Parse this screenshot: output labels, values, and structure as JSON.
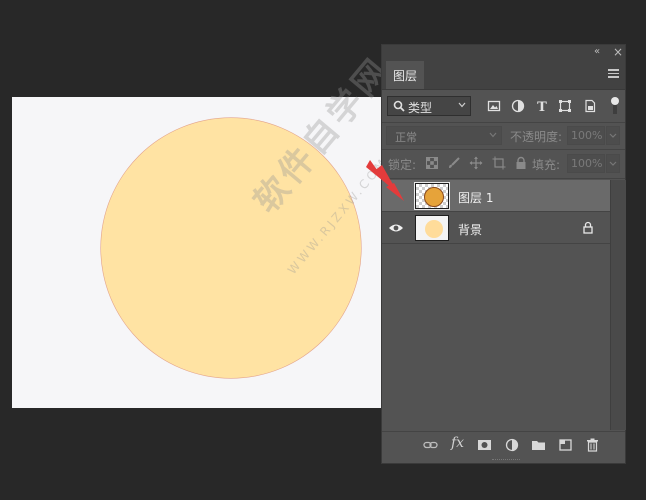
{
  "window": {
    "collapse_glyph": "«",
    "close_glyph": "×"
  },
  "panel": {
    "tab_label": "图层",
    "menu_icon": "hamburger-menu-icon",
    "filter": {
      "type_label": "类型",
      "icons": [
        "image-filter-icon",
        "adjustment-filter-icon",
        "type-filter-icon",
        "shape-filter-icon",
        "smartobject-filter-icon"
      ]
    },
    "blend": {
      "mode_value": "正常",
      "opacity_label": "不透明度:",
      "opacity_value": "100%"
    },
    "lock": {
      "label": "锁定:",
      "fill_label": "填充:",
      "fill_value": "100%"
    },
    "layers": [
      {
        "name": "图层 1",
        "selected": true,
        "visible": false,
        "locked": false
      },
      {
        "name": "背景",
        "selected": false,
        "visible": true,
        "locked": true
      }
    ],
    "bottom_icons": [
      "link-layers-icon",
      "fx-icon",
      "layer-mask-icon",
      "adjustment-layer-icon",
      "group-folder-icon",
      "new-layer-icon",
      "trash-icon"
    ],
    "fx_label": "fx"
  },
  "canvas": {
    "background_color": "#f6f6f8",
    "circle_color": "#ffe3a3"
  },
  "watermark": {
    "text": "软件自学网",
    "url": "WWW.RJZXW.COM"
  },
  "colors": {
    "panel_bg": "#535353",
    "selected_row": "#6a6a6a",
    "arrow": "#e33b3b"
  }
}
